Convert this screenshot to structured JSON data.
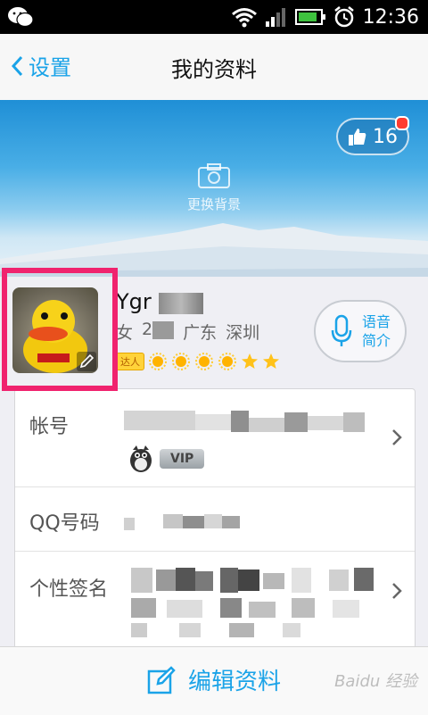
{
  "statusbar": {
    "time": "12:36"
  },
  "nav": {
    "back_label": "设置",
    "title": "我的资料"
  },
  "banner": {
    "likes": "16",
    "camera_label": "更换背景"
  },
  "profile": {
    "nickname": "Ygr",
    "gender": "女",
    "age_partial": "2",
    "province": "广东",
    "city": "深圳",
    "daren_badge": "达人",
    "level_icons": [
      "sun",
      "sun",
      "sun",
      "sun",
      "star",
      "star"
    ],
    "voice_label": "语音简介"
  },
  "info_rows": {
    "account_label": "帐号",
    "vip_label": "VIP",
    "qq_label": "QQ号码",
    "signature_label": "个性签名"
  },
  "bottom": {
    "edit_label": "编辑资料",
    "watermark": "Baidu 经验"
  },
  "colors": {
    "accent": "#1aa3e8",
    "highlight_frame": "#f0236e"
  }
}
